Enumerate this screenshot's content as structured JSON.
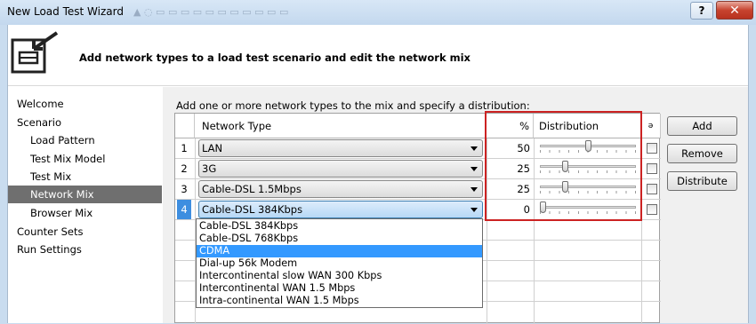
{
  "window": {
    "title": "New Load Test Wizard",
    "background_text": "▲ ◌ ▭  ▭ ▭ ▭ ▭ ▭ ▭ ▭ ▭ ▭ ▭",
    "help_label": "?",
    "close_label": "✕"
  },
  "header": {
    "icon": "wizard-network-icon",
    "title": "Add network types to a load test scenario and edit the network mix"
  },
  "nav": {
    "items": [
      {
        "label": "Welcome",
        "level": 0,
        "selected": false
      },
      {
        "label": "Scenario",
        "level": 0,
        "selected": false
      },
      {
        "label": "Load Pattern",
        "level": 1,
        "selected": false
      },
      {
        "label": "Test Mix Model",
        "level": 1,
        "selected": false
      },
      {
        "label": "Test Mix",
        "level": 1,
        "selected": false
      },
      {
        "label": "Network Mix",
        "level": 1,
        "selected": true
      },
      {
        "label": "Browser Mix",
        "level": 1,
        "selected": false
      },
      {
        "label": "Counter Sets",
        "level": 0,
        "selected": false
      },
      {
        "label": "Run Settings",
        "level": 0,
        "selected": false
      }
    ]
  },
  "main": {
    "instruction": "Add one or more network types to the mix and specify a distribution:",
    "grid": {
      "headers": {
        "network_type": "Network Type",
        "percent": "%",
        "distribution": "Distribution",
        "lock": "ə"
      },
      "rows": [
        {
          "num": "1",
          "type": "LAN",
          "pct": "50",
          "level": 0.5,
          "selected": false
        },
        {
          "num": "2",
          "type": "3G",
          "pct": "25",
          "level": 0.25,
          "selected": false
        },
        {
          "num": "3",
          "type": "Cable-DSL 1.5Mbps",
          "pct": "25",
          "level": 0.25,
          "selected": false
        },
        {
          "num": "4",
          "type": "Cable-DSL 384Kbps",
          "pct": "0",
          "level": 0.0,
          "selected": true
        }
      ]
    },
    "dropdown": {
      "options": [
        "Cable-DSL 384Kbps",
        "Cable-DSL 768Kbps",
        "CDMA",
        "Dial-up 56k Modem",
        "Intercontinental slow WAN 300 Kbps",
        "Intercontinental WAN 1.5 Mbps",
        "Intra-continental WAN 1.5 Mbps"
      ],
      "highlighted": "CDMA"
    }
  },
  "buttons": {
    "add": "Add",
    "remove": "Remove",
    "distribute": "Distribute"
  },
  "colors": {
    "highlight_box": "#cc2222",
    "selection": "#3399ff",
    "nav_selected": "#6f6f6f"
  }
}
